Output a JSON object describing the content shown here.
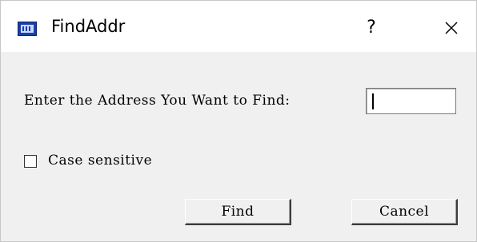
{
  "window": {
    "title": "FindAddr",
    "icon": "app-window-icon",
    "help_label": "?",
    "close_icon": "close-icon"
  },
  "form": {
    "prompt_label": "Enter the Address You Want to Find:",
    "address_value": "",
    "case_sensitive_label": "Case sensitive",
    "case_sensitive_checked": false
  },
  "buttons": {
    "find_label": "Find",
    "cancel_label": "Cancel"
  }
}
